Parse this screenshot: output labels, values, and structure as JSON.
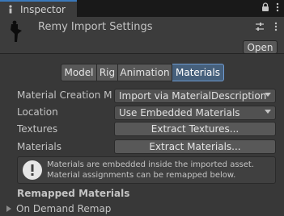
{
  "window": {
    "tab_label": "Inspector",
    "icons": [
      "inspector-icon",
      "lock-icon",
      "more-icon"
    ]
  },
  "header": {
    "title": "Remy Import Settings",
    "open_label": "Open"
  },
  "toolbar": {
    "tabs": [
      "Model",
      "Rig",
      "Animation",
      "Materials"
    ],
    "active": "Materials"
  },
  "fields": {
    "material_creation_mode": {
      "label": "Material Creation Mo",
      "value": "Import via MaterialDescription"
    },
    "location": {
      "label": "Location",
      "value": "Use Embedded Materials"
    },
    "textures": {
      "label": "Textures",
      "button": "Extract Textures..."
    },
    "materials": {
      "label": "Materials",
      "button": "Extract Materials..."
    }
  },
  "help": {
    "line1": "Materials are embedded inside the imported asset.",
    "line2": "Material assignments can be remapped below."
  },
  "remapped": {
    "title": "Remapped Materials",
    "foldout": "On Demand Remap"
  },
  "colors": {
    "background": "#383838",
    "accent": "#3a79bb",
    "active_tab": "#46607c"
  }
}
